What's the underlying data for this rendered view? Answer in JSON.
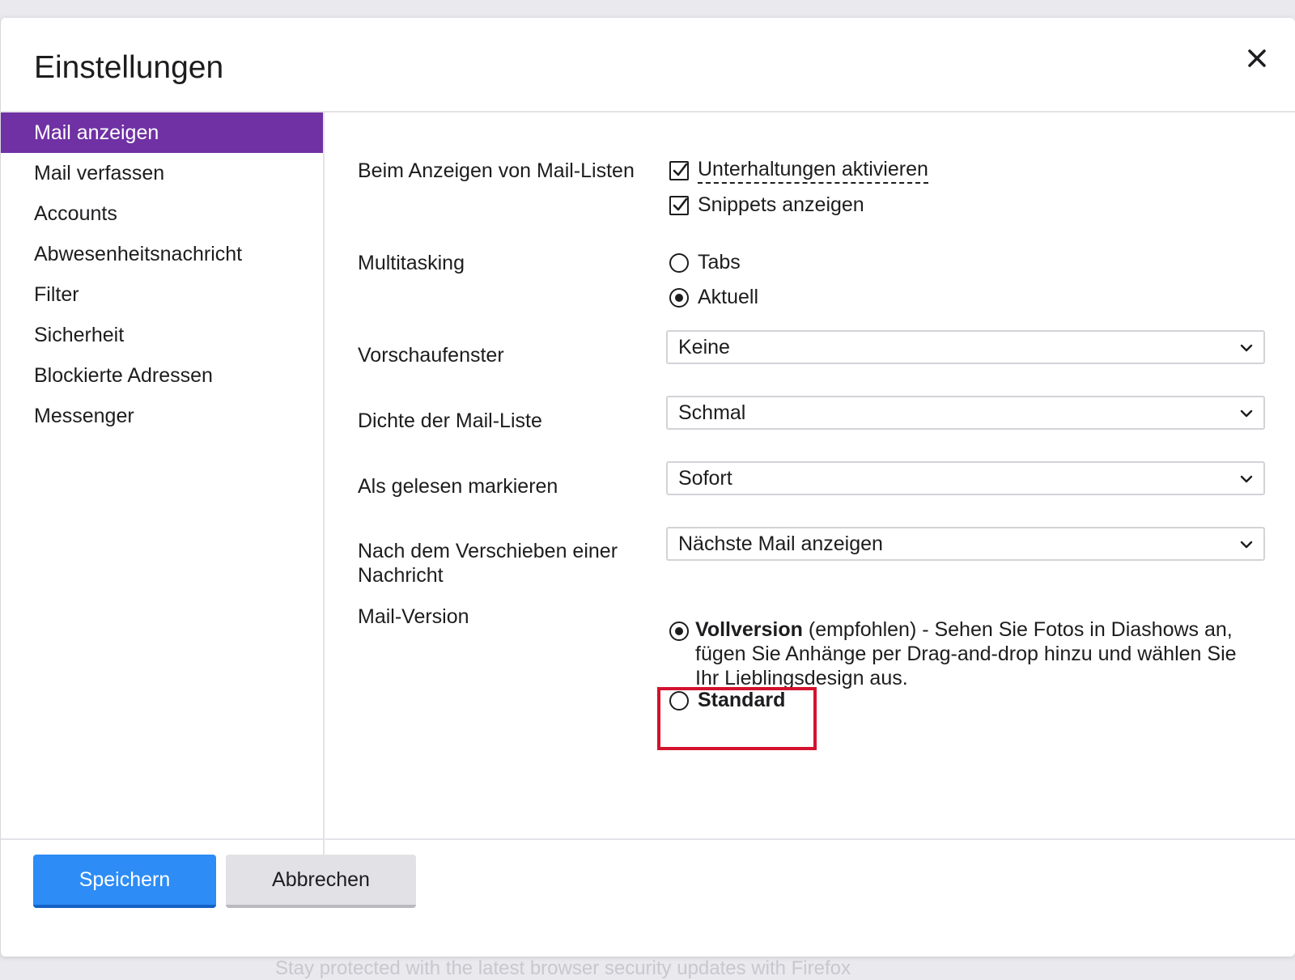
{
  "background_text": "Stay protected with the latest browser security updates with Firefox",
  "dialog": {
    "title": "Einstellungen",
    "close_icon": "close-icon"
  },
  "sidebar": {
    "items": [
      {
        "label": "Mail anzeigen",
        "active": true
      },
      {
        "label": "Mail verfassen"
      },
      {
        "label": "Accounts"
      },
      {
        "label": "Abwesenheitsnachricht"
      },
      {
        "label": "Filter"
      },
      {
        "label": "Sicherheit"
      },
      {
        "label": "Blockierte Adressen"
      },
      {
        "label": "Messenger"
      }
    ],
    "active_color": "#6f31a3"
  },
  "settings": {
    "mail_lists": {
      "label": "Beim Anzeigen von Mail-Listen",
      "options": [
        {
          "label": "Unterhaltungen aktivieren",
          "checked": true
        },
        {
          "label": "Snippets anzeigen",
          "checked": true
        }
      ]
    },
    "multitasking": {
      "label": "Multitasking",
      "options": [
        {
          "label": "Tabs",
          "selected": false
        },
        {
          "label": "Aktuell",
          "selected": true
        }
      ]
    },
    "preview": {
      "label": "Vorschaufenster",
      "value": "Keine"
    },
    "density": {
      "label": "Dichte der Mail-Liste",
      "value": "Schmal"
    },
    "mark_read": {
      "label": "Als gelesen markieren",
      "value": "Sofort"
    },
    "after_move": {
      "label": "Nach dem Verschieben einer Nachricht",
      "value": "Nächste Mail anzeigen"
    },
    "mail_version": {
      "label": "Mail-Version",
      "full": {
        "title": "Vollversion",
        "description": " (empfohlen) - Sehen Sie Fotos in Diashows an, fügen Sie Anhänge per Drag-and-drop hinzu und wählen Sie Ihr Lieblingsdesign aus.",
        "selected": true
      },
      "standard": {
        "title": "Standard",
        "selected": false,
        "highlight_color": "#d3122e"
      }
    }
  },
  "footer": {
    "save_label": "Speichern",
    "cancel_label": "Abbrechen",
    "primary_color": "#2d8cf5"
  }
}
